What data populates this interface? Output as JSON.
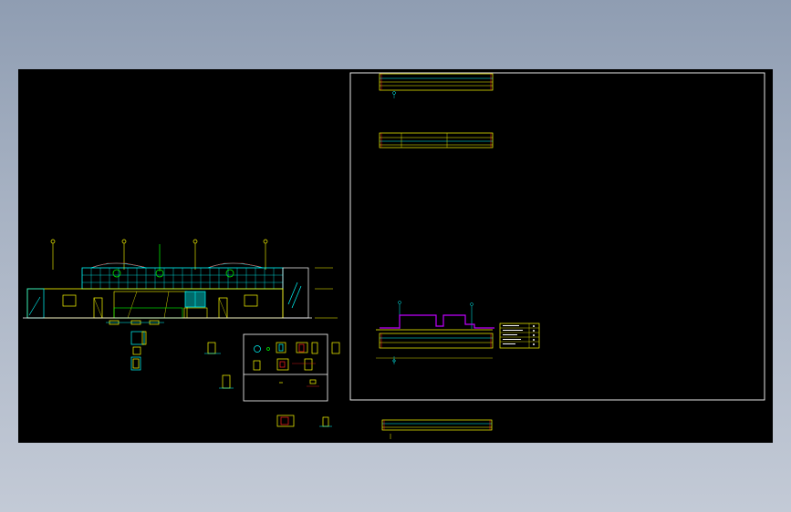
{
  "window": {
    "title": ""
  },
  "colors": {
    "canvas_background": "#000000",
    "app_background": "#9aa6b9",
    "yellow": "#ffff00",
    "cyan": "#00ffff",
    "green": "#00ff00",
    "magenta": "#c000ff",
    "red": "#ff2020",
    "white": "#ffffff"
  },
  "drawing": {
    "elevation_labels": [
      "",
      "",
      "",
      ""
    ],
    "grid_axis_marks": [
      "A",
      "B",
      "C",
      "D"
    ],
    "layout_frame_label": "",
    "legend_rows": 5
  }
}
